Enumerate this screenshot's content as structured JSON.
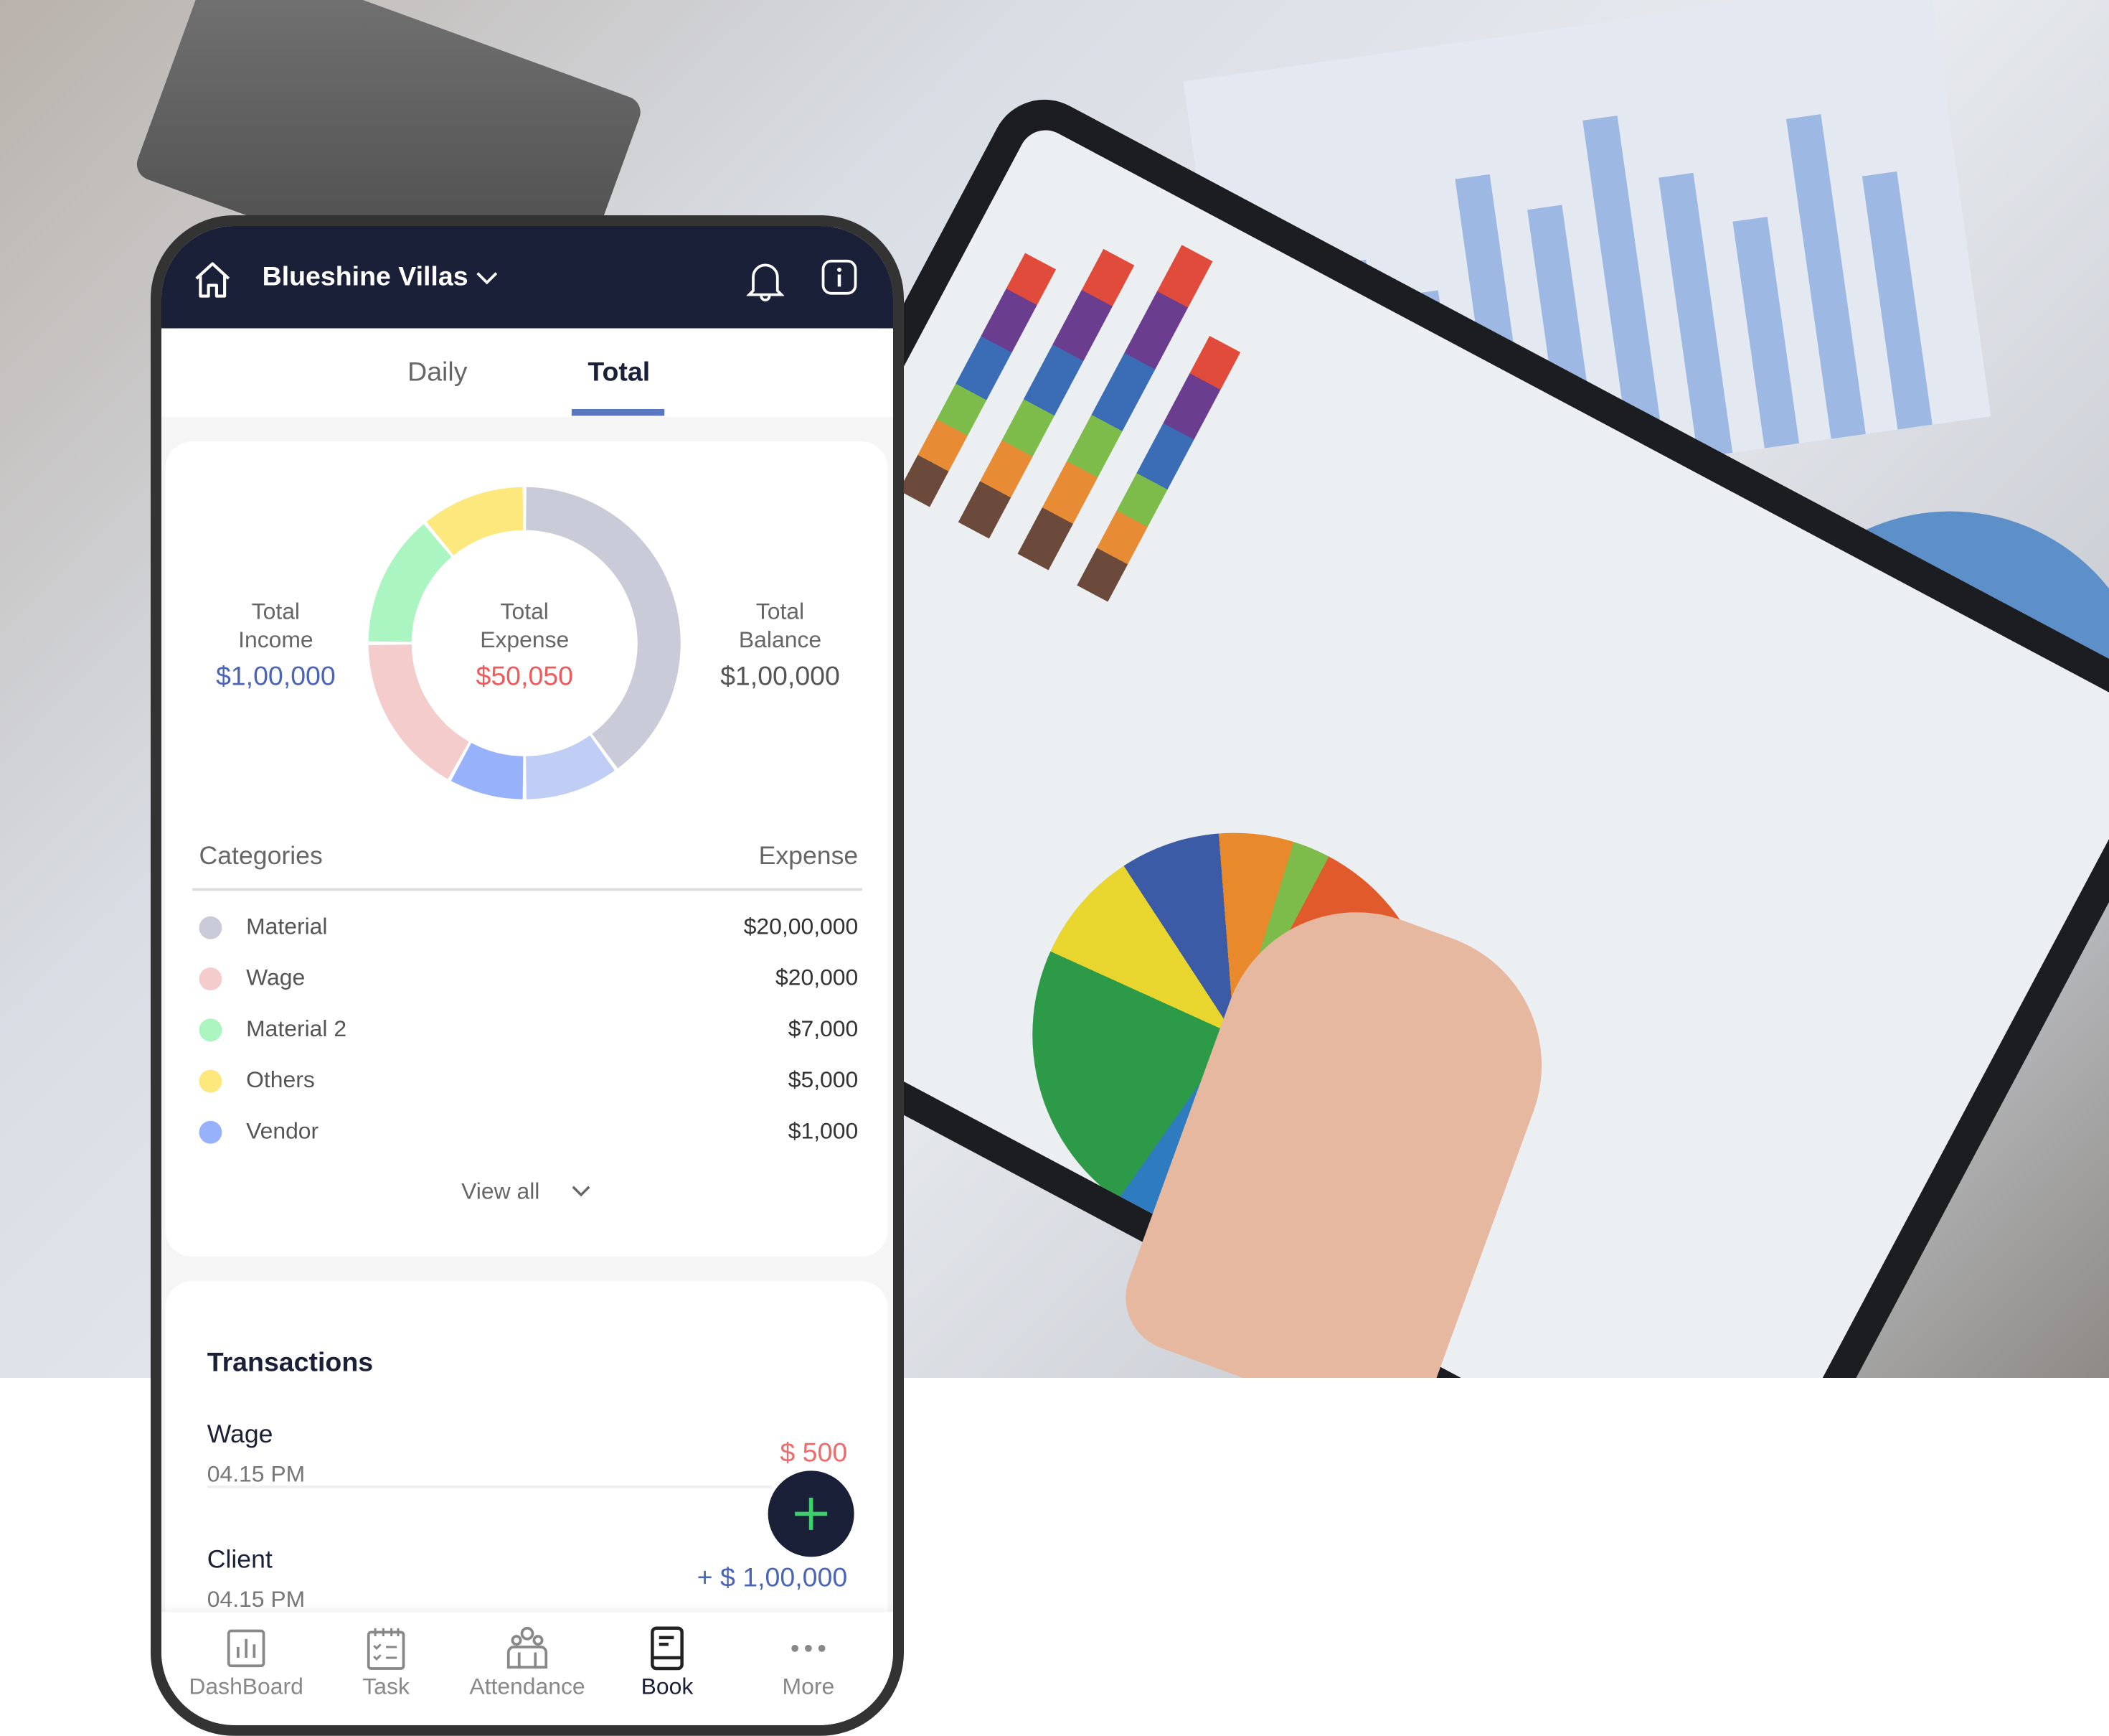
{
  "header": {
    "project": "Blueshine Villas",
    "icons": [
      "home-icon",
      "chevron-down-icon",
      "bell-icon",
      "info-icon"
    ]
  },
  "tabs": [
    {
      "label": "Daily",
      "active": false
    },
    {
      "label": "Total",
      "active": true
    }
  ],
  "summary": {
    "income": {
      "label_1": "Total",
      "label_2": "Income",
      "value": "$1,00,000",
      "color": "#4a64b8"
    },
    "expense": {
      "label_1": "Total",
      "label_2": "Expense",
      "value": "$50,050",
      "color": "#ef5a5a"
    },
    "balance": {
      "label_1": "Total",
      "label_2": "Balance",
      "value": "$1,00,000",
      "color": "#555555"
    }
  },
  "donut_segments": [
    {
      "share": 40,
      "color": "#c9ccd8"
    },
    {
      "share": 10,
      "color": "#c0cef5"
    },
    {
      "share": 8,
      "color": "#97b1fb"
    },
    {
      "share": 17,
      "color": "#f4cccc"
    },
    {
      "share": 14,
      "color": "#aaf5c0"
    },
    {
      "share": 11,
      "color": "#fde87e"
    }
  ],
  "categories": {
    "header_left": "Categories",
    "header_right": "Expense",
    "items": [
      {
        "name": "Material",
        "amount": "$20,00,000",
        "color": "#c9ccd8"
      },
      {
        "name": "Wage",
        "amount": "$20,000",
        "color": "#f4cccc"
      },
      {
        "name": "Material 2",
        "amount": "$7,000",
        "color": "#aaf5c0"
      },
      {
        "name": "Others",
        "amount": "$5,000",
        "color": "#fde87e"
      },
      {
        "name": "Vendor",
        "amount": "$1,000",
        "color": "#97b1fb"
      }
    ],
    "view_all": "View all"
  },
  "transactions": {
    "title": "Transactions",
    "items": [
      {
        "name": "Wage",
        "time": "04.15 PM",
        "amount": "$ 500",
        "color": "#ef6b6b"
      },
      {
        "name": "Client",
        "time": "04.15 PM",
        "amount": "+ $ 1,00,000",
        "color": "#4a64b8"
      }
    ]
  },
  "fab": {
    "icon": "plus-icon",
    "color": "#3ccf6a"
  },
  "bottom_nav": [
    {
      "label": "DashBoard",
      "icon": "bar-chart-icon",
      "active": false
    },
    {
      "label": "Task",
      "icon": "checklist-icon",
      "active": false
    },
    {
      "label": "Attendance",
      "icon": "people-icon",
      "active": false
    },
    {
      "label": "Book",
      "icon": "book-icon",
      "active": true
    },
    {
      "label": "More",
      "icon": "more-dots-icon",
      "active": false
    }
  ]
}
